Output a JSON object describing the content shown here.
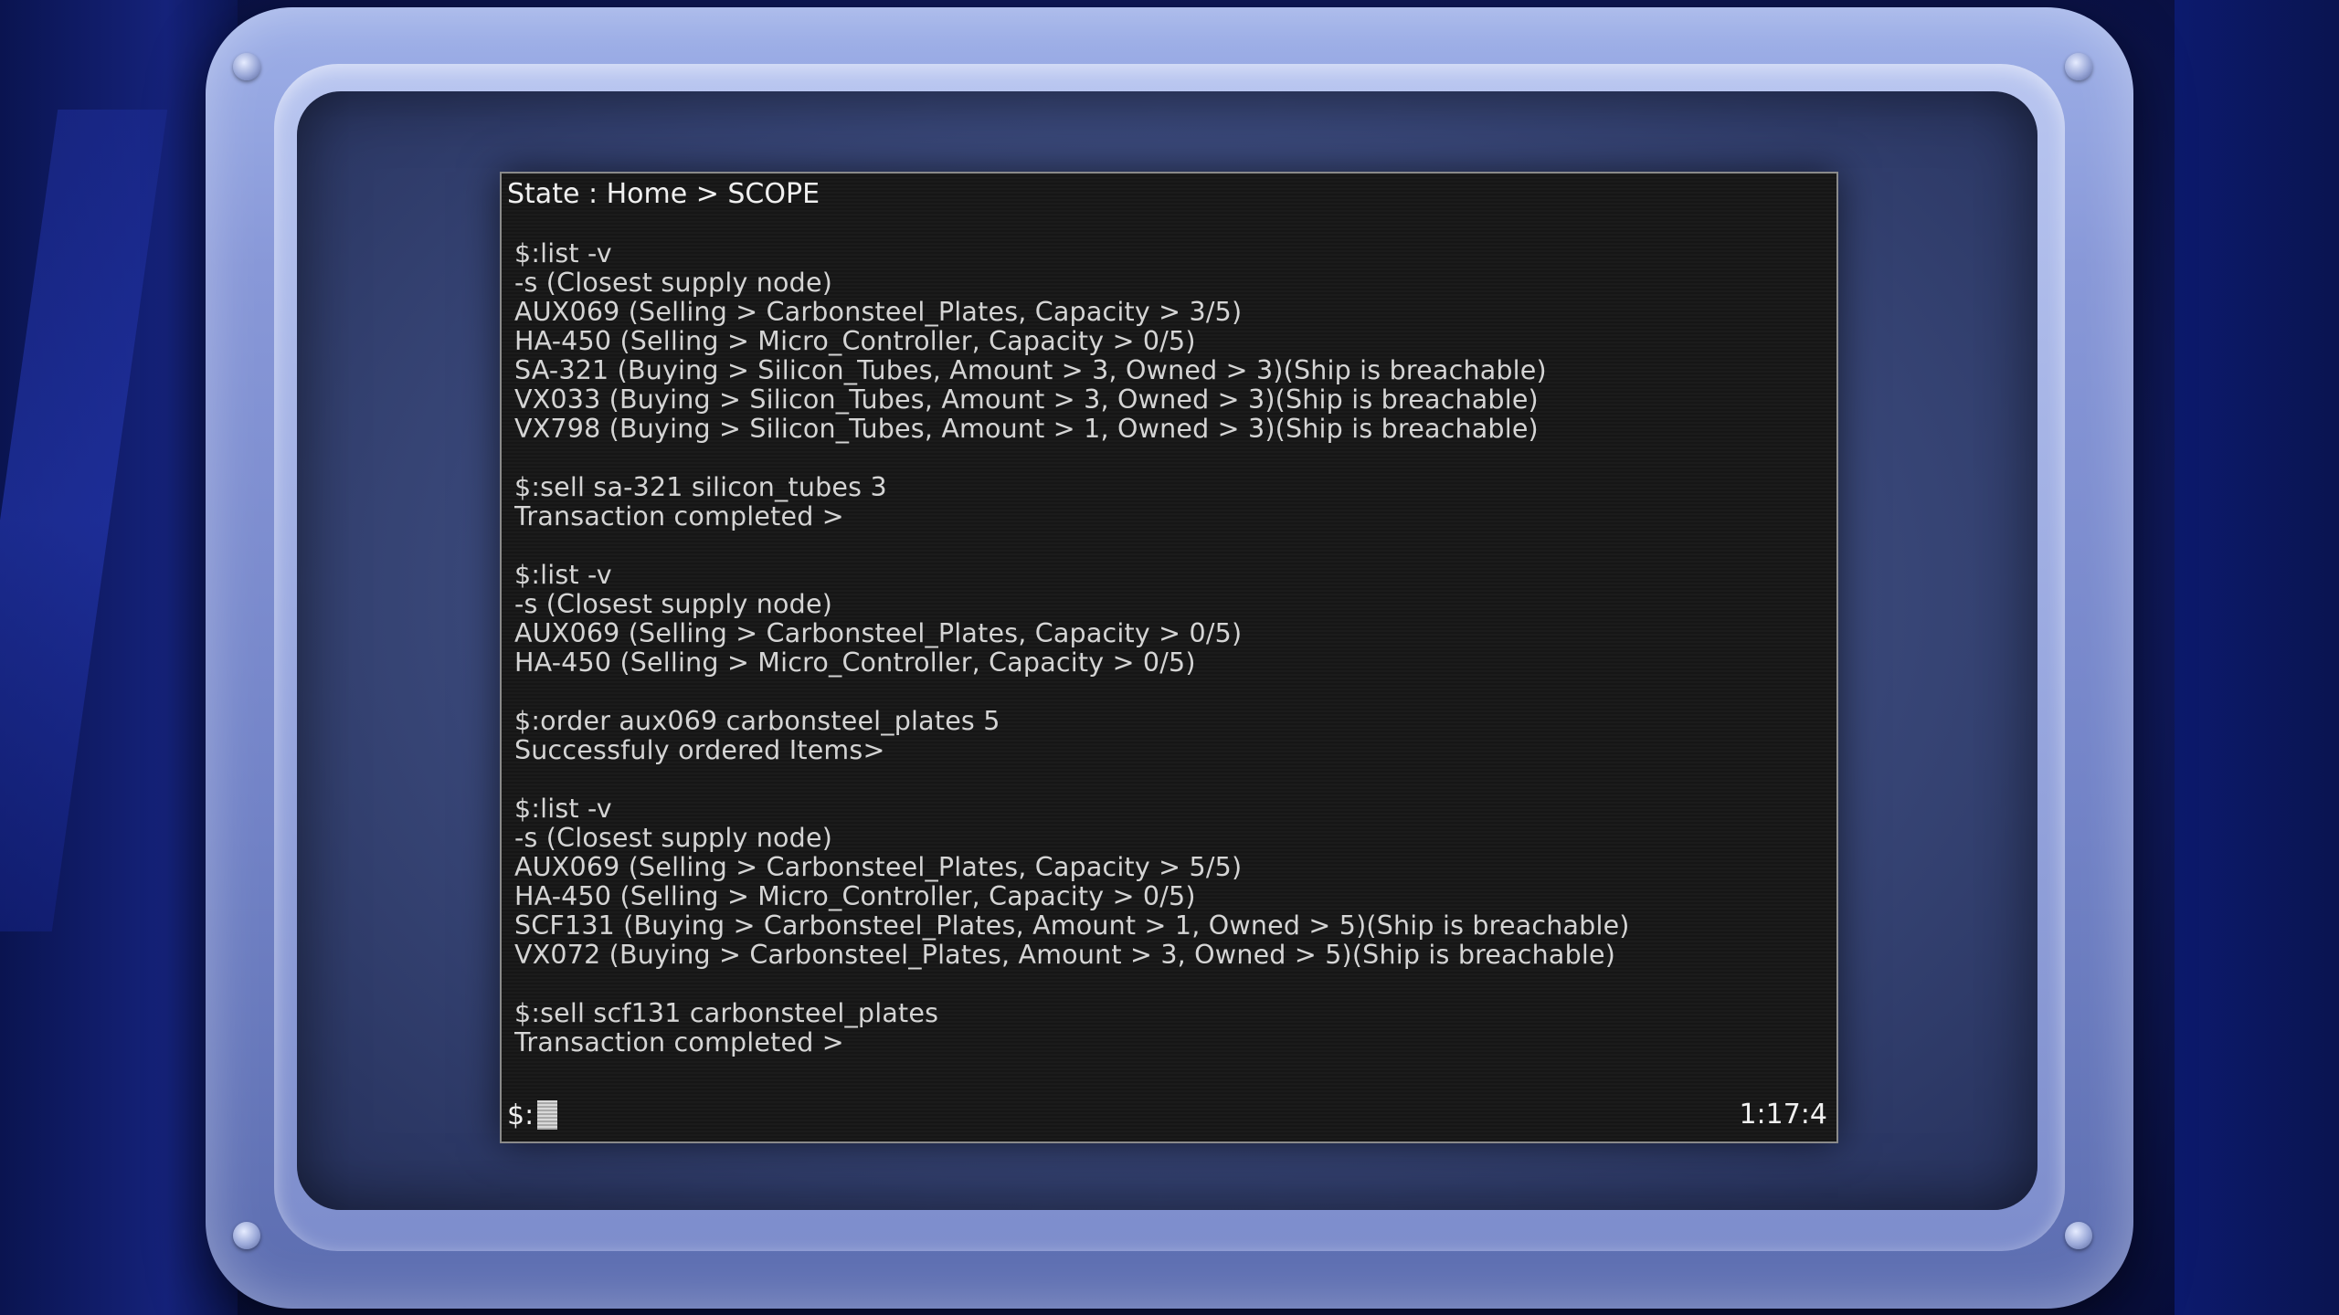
{
  "terminal": {
    "state_line": "State : Home > SCOPE",
    "prompt": "$:",
    "clock": "1:17:4",
    "log_lines": [
      "$:list -v",
      "-s (Closest supply node)",
      "AUX069 (Selling > Carbonsteel_Plates, Capacity > 3/5)",
      "HA-450 (Selling > Micro_Controller, Capacity > 0/5)",
      "SA-321 (Buying > Silicon_Tubes, Amount > 3, Owned > 3)(Ship is breachable)",
      "VX033 (Buying > Silicon_Tubes, Amount > 3, Owned > 3)(Ship is breachable)",
      "VX798 (Buying > Silicon_Tubes, Amount > 1, Owned > 3)(Ship is breachable)",
      "",
      "$:sell sa-321 silicon_tubes 3",
      "Transaction completed >",
      "",
      "$:list -v",
      "-s (Closest supply node)",
      "AUX069 (Selling > Carbonsteel_Plates, Capacity > 0/5)",
      "HA-450 (Selling > Micro_Controller, Capacity > 0/5)",
      "",
      "$:order aux069 carbonsteel_plates 5",
      "Successfuly ordered Items>",
      "",
      "$:list -v",
      "-s (Closest supply node)",
      "AUX069 (Selling > Carbonsteel_Plates, Capacity > 5/5)",
      "HA-450 (Selling > Micro_Controller, Capacity > 0/5)",
      "SCF131 (Buying > Carbonsteel_Plates, Amount > 1, Owned > 5)(Ship is breachable)",
      "VX072 (Buying > Carbonsteel_Plates, Amount > 3, Owned > 5)(Ship is breachable)",
      "",
      "$:sell scf131 carbonsteel_plates",
      "Transaction completed >"
    ]
  }
}
